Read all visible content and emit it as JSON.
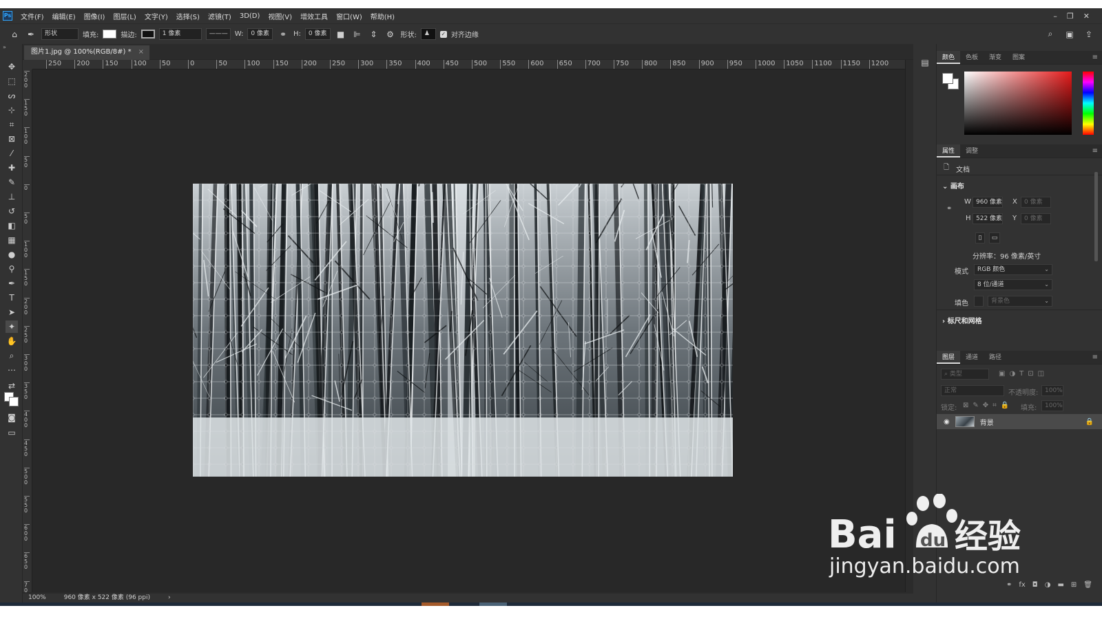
{
  "app": {
    "logo": "Ps"
  },
  "menubar": {
    "items": [
      "文件(F)",
      "编辑(E)",
      "图像(I)",
      "图层(L)",
      "文字(Y)",
      "选择(S)",
      "滤镜(T)",
      "3D(D)",
      "视图(V)",
      "增效工具",
      "窗口(W)",
      "帮助(H)"
    ],
    "window_controls": [
      "–",
      "❐",
      "✕"
    ]
  },
  "options_bar": {
    "mode": "形状",
    "fill_label": "填充:",
    "stroke_label": "描边:",
    "stroke_size": "1 像素",
    "w_label": "W:",
    "w_value": "0 像素",
    "h_label": "H:",
    "h_value": "0 像素",
    "shape_label": "形状:",
    "align_edges_label": "对齐边缘",
    "align_edges_checked": true
  },
  "document": {
    "tab_title": "图片1.jpg @ 100%(RGB/8#) *",
    "close": "×"
  },
  "rulers": {
    "horizontal": [
      "250",
      "200",
      "150",
      "100",
      "50",
      "0",
      "50",
      "100",
      "150",
      "200",
      "250",
      "300",
      "350",
      "400",
      "450",
      "500",
      "550",
      "600",
      "650",
      "700",
      "750",
      "800",
      "850",
      "900",
      "950",
      "1000",
      "1050",
      "1100",
      "1150",
      "1200"
    ],
    "vertical": [
      "200",
      "150",
      "100",
      "50",
      "0",
      "50",
      "100",
      "150",
      "200",
      "250",
      "300",
      "350",
      "400",
      "450",
      "500",
      "550",
      "600",
      "650",
      "700"
    ]
  },
  "status_bar": {
    "zoom": "100%",
    "doc_info": "960 像素 x 522 像素 (96 ppi)",
    "arrow": "›"
  },
  "color_panel": {
    "tabs": [
      "颜色",
      "色板",
      "渐变",
      "图案"
    ],
    "active_tab": "颜色",
    "foreground": "#ffffff",
    "background": "#ffffff"
  },
  "properties_panel": {
    "tabs": [
      "属性",
      "调整"
    ],
    "active_tab": "属性",
    "doc_label": "文档",
    "canvas_section": "画布",
    "w_label": "W",
    "w_value": "960 像素",
    "x_label": "X",
    "x_value": "0 像素",
    "h_label": "H",
    "h_value": "522 像素",
    "y_label": "Y",
    "y_value": "0 像素",
    "resolution": "分辨率：96 像素/英寸",
    "mode_label": "模式",
    "mode_value": "RGB 颜色",
    "depth_value": "8 位/通道",
    "fill_label": "填色",
    "fill_value": "背景色",
    "rulers_section": "标尺和网格"
  },
  "layers_panel": {
    "tabs": [
      "图层",
      "通道",
      "路径"
    ],
    "active_tab": "图层",
    "search_placeholder": "类型",
    "blend_mode": "正常",
    "opacity_label": "不透明度:",
    "opacity_value": "100%",
    "lock_label": "锁定:",
    "fill_label": "填充:",
    "fill_value": "100%",
    "layers": [
      {
        "name": "背景",
        "visible": true,
        "locked": true
      }
    ],
    "bottom_icons": [
      "link-icon",
      "fx-icon",
      "mask-icon",
      "adjustment-icon",
      "group-icon",
      "new-layer-icon",
      "trash-icon"
    ]
  },
  "watermark": {
    "brand": "Bai",
    "brand_tail": "经验",
    "url": "jingyan.baidu.com"
  }
}
